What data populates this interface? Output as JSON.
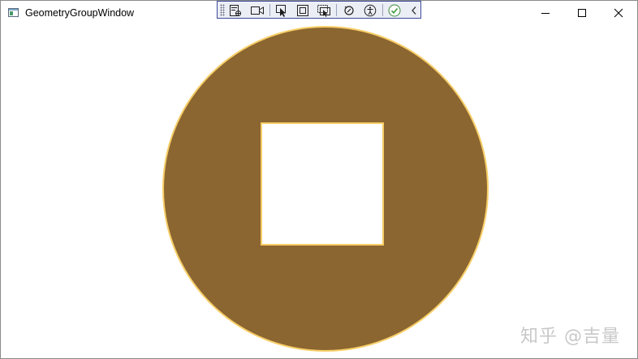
{
  "window": {
    "title": "GeometryGroupWindow"
  },
  "devtools": {
    "buttons": [
      {
        "name": "go-to-live-visual-tree"
      },
      {
        "name": "show-in-xaml-live-preview"
      },
      {
        "name": "select-element"
      },
      {
        "name": "display-layout-adorners"
      },
      {
        "name": "track-focused-element"
      },
      {
        "name": "hot-reload"
      },
      {
        "name": "accessibility-scanner"
      },
      {
        "name": "binding-status"
      },
      {
        "name": "collapse-toolbar"
      }
    ]
  },
  "geometry": {
    "fill_color": "#8B6631",
    "stroke_color": "#F7CE67",
    "hole_color": "#FFFFFF"
  },
  "watermark": {
    "text": "知乎 @吉量"
  }
}
